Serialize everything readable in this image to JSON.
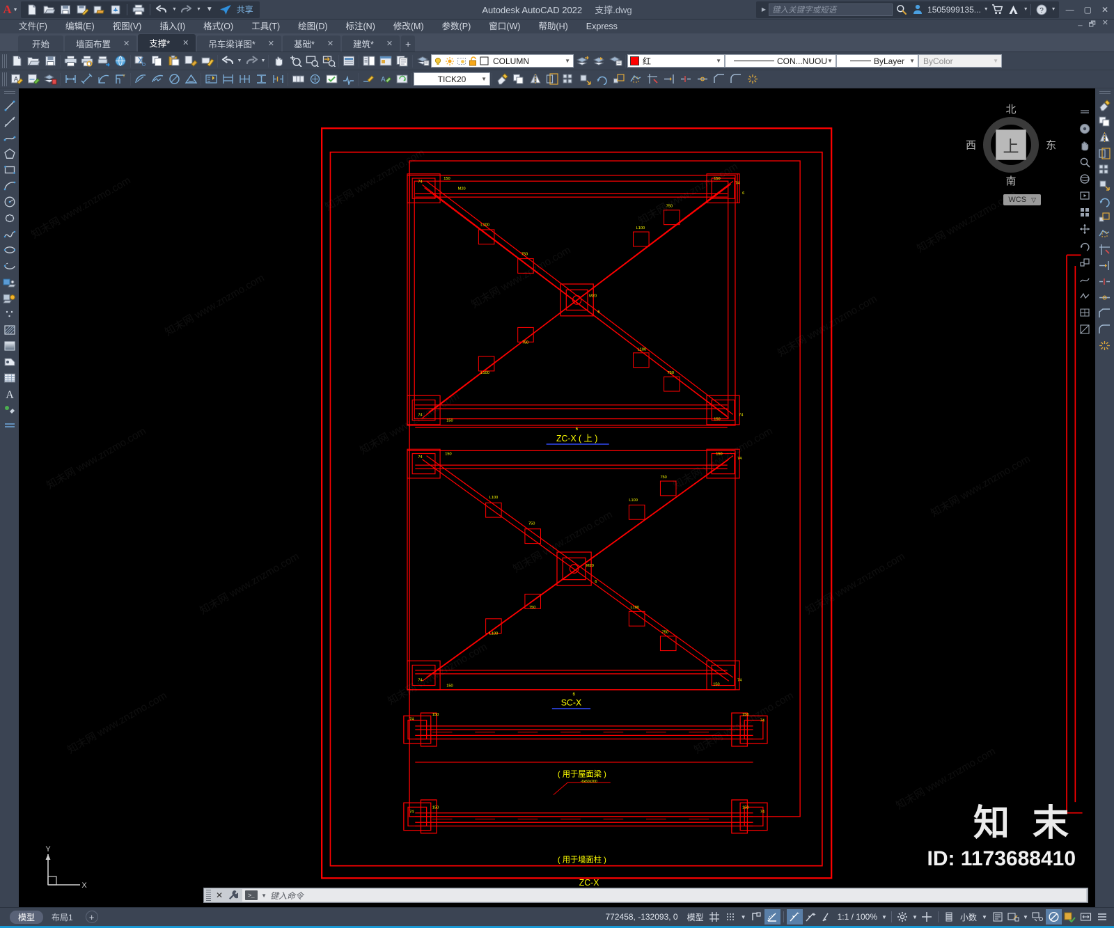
{
  "window": {
    "title_app": "Autodesk AutoCAD 2022",
    "title_file": "支撑.dwg",
    "minimize": "—",
    "maximize": "▢",
    "close": "✕",
    "min2": "_",
    "restore2": "🗗",
    "close2": "✕"
  },
  "quick_access": {
    "share_label": "共享",
    "icons": [
      "new-icon",
      "open-icon",
      "save-icon",
      "saveas-icon",
      "export-icon",
      "cloud-save-icon",
      "plot-icon",
      "undo-icon",
      "redo-icon",
      "customize-icon",
      "share-icon"
    ]
  },
  "infocenter": {
    "placeholder": "键入关键字或短语",
    "search_icon": "search-icon",
    "user_icon": "user-icon",
    "user_label": "1505999135...",
    "cart_icon": "cart-icon",
    "autodesk_icon": "autodesk-a-icon",
    "help_icon": "help-icon"
  },
  "menubar": {
    "items": [
      {
        "label": "文件(F)",
        "name": "menu-file"
      },
      {
        "label": "编辑(E)",
        "name": "menu-edit"
      },
      {
        "label": "视图(V)",
        "name": "menu-view"
      },
      {
        "label": "插入(I)",
        "name": "menu-insert"
      },
      {
        "label": "格式(O)",
        "name": "menu-format"
      },
      {
        "label": "工具(T)",
        "name": "menu-tools"
      },
      {
        "label": "绘图(D)",
        "name": "menu-draw"
      },
      {
        "label": "标注(N)",
        "name": "menu-dimension"
      },
      {
        "label": "修改(M)",
        "name": "menu-modify"
      },
      {
        "label": "参数(P)",
        "name": "menu-parametric"
      },
      {
        "label": "窗口(W)",
        "name": "menu-window"
      },
      {
        "label": "帮助(H)",
        "name": "menu-help"
      },
      {
        "label": "Express",
        "name": "menu-express"
      }
    ]
  },
  "doctabs": {
    "tabs": [
      {
        "label": "开始",
        "active": false,
        "closable": false
      },
      {
        "label": "墙面布置",
        "active": false,
        "closable": true
      },
      {
        "label": "支撑*",
        "active": true,
        "closable": true
      },
      {
        "label": "吊车梁详图*",
        "active": false,
        "closable": true
      },
      {
        "label": "基础*",
        "active": false,
        "closable": true
      },
      {
        "label": "建筑*",
        "active": false,
        "closable": true
      }
    ],
    "close_glyph": "✕",
    "add_glyph": "+"
  },
  "properties_toolbar": {
    "layer_name": "COLUMN",
    "color_value": "红",
    "color_hex": "#ff0000",
    "linetype_value": "CON...NUOU",
    "lineweight_value": "ByLayer",
    "plotstyle_value": "ByColor",
    "dimstyle_value": "TICK20"
  },
  "canvas": {
    "background_hex": "#000000",
    "drawing_color_hex": "#ff0000",
    "text_color_hex": "#ffff00",
    "labels": [
      {
        "text": "ZC-X ( 上 )",
        "name": "label-zcx-top"
      },
      {
        "text": "SC-X",
        "name": "label-scx"
      },
      {
        "text": "( 用于屋面梁 )",
        "name": "label-roof-beam"
      },
      {
        "text": "( 用于墙面柱 )",
        "name": "label-wall-column"
      },
      {
        "text": "ZC-X",
        "name": "label-zcx"
      }
    ]
  },
  "viewcube": {
    "north": "北",
    "south": "南",
    "west": "西",
    "east": "东",
    "top_face": "上",
    "wcs_label": "WCS",
    "wcs_caret": "▽"
  },
  "ucs": {
    "y_label": "Y",
    "x_label": "X"
  },
  "commandline": {
    "placeholder": "键入命令",
    "close_glyph": "✕",
    "wrench_icon": "wrench-icon",
    "prompt_icon": "command-prompt-icon"
  },
  "statusbar": {
    "model_tab": "模型",
    "layout_tab": "布局1",
    "add_layout": "+",
    "coordinates": "772458, -132093, 0",
    "space_label": "模型",
    "scale_label": "1:1 / 100%",
    "units_label": "小数",
    "icons": [
      "grid-icon",
      "snap-icon",
      "snap-caret",
      "ortho-icon",
      "polar-icon",
      "osnap-icon",
      "otrack-icon",
      "lineweight-icon",
      "transparency-icon",
      "selectioncycling-icon",
      "annotation-visibility-icon",
      "annotation-scale-icon",
      "workspace-icon",
      "hardware-accel-icon",
      "isolate-icon",
      "fullscreen-icon",
      "customize-icon"
    ]
  },
  "watermarks": {
    "text": "知末网 www.znzmo.com",
    "brand": "知 末",
    "id": "ID: 1173688410"
  }
}
